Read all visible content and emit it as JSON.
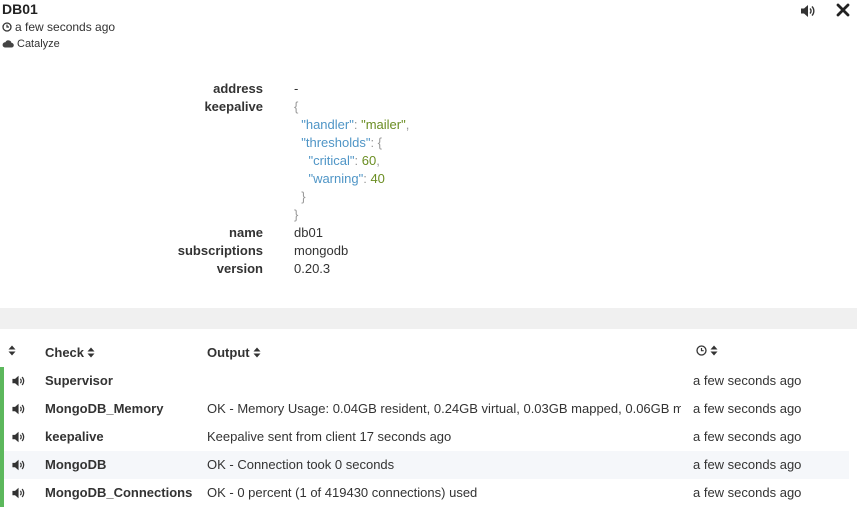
{
  "client": {
    "name": "DB01",
    "time": "a few seconds ago",
    "datacenter": "Catalyze"
  },
  "details": {
    "address_label": "address",
    "address_value": "-",
    "keepalive_label": "keepalive",
    "keepalive_json": {
      "handler_key": "\"handler\"",
      "handler_value": "\"mailer\"",
      "thresholds_key": "\"thresholds\"",
      "critical_key": "\"critical\"",
      "critical_value": "60",
      "warning_key": "\"warning\"",
      "warning_value": "40"
    },
    "name_label": "name",
    "name_value": "db01",
    "subscriptions_label": "subscriptions",
    "subscriptions_value": "mongodb",
    "version_label": "version",
    "version_value": "0.20.3"
  },
  "table": {
    "headers": {
      "check": "Check",
      "output": "Output"
    },
    "rows": [
      {
        "check": "Supervisor",
        "output": "",
        "time": "a few seconds ago"
      },
      {
        "check": "MongoDB_Memory",
        "output": "OK - Memory Usage: 0.04GB resident, 0.24GB virtual, 0.03GB mapped, 0.06GB m...",
        "time": "a few seconds ago"
      },
      {
        "check": "keepalive",
        "output": "Keepalive sent from client 17 seconds ago",
        "time": "a few seconds ago"
      },
      {
        "check": "MongoDB",
        "output": "OK - Connection took 0 seconds",
        "time": "a few seconds ago"
      },
      {
        "check": "MongoDB_Connections",
        "output": "OK - 0 percent (1 of 419430 connections) used",
        "time": "a few seconds ago"
      }
    ]
  },
  "colors": {
    "status_ok": "#5cb85c",
    "json_key": "#4f95c6",
    "json_value": "#6b8e23"
  },
  "icons": [
    "clock-icon",
    "cloud-icon",
    "volume-icon",
    "close-icon",
    "sort-icon"
  ]
}
